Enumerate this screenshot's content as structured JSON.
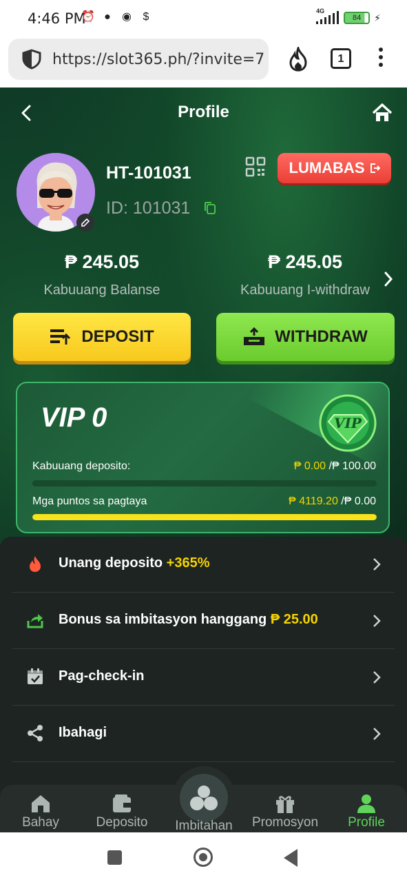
{
  "status_bar": {
    "time": "4:46 PM",
    "network": "4G",
    "battery": "84"
  },
  "browser": {
    "url": "https://slot365.ph/?invite=7",
    "tab_count": "1"
  },
  "header": {
    "title": "Profile"
  },
  "profile": {
    "username": "HT-101031",
    "id_text": "ID: 101031",
    "logout_label": "LUMABAS"
  },
  "balances": {
    "total_balance": "₱ 245.05",
    "total_balance_label": "Kabuuang Balanse",
    "withdrawable": "₱ 245.05",
    "withdrawable_label": "Kabuuang I-withdraw"
  },
  "actions": {
    "deposit_label": "DEPOSIT",
    "withdraw_label": "WITHDRAW"
  },
  "vip": {
    "title": "VIP 0",
    "badge_text": "VIP",
    "deposit_label": "Kabuuang deposito:",
    "deposit_current": "₱ 0.00",
    "deposit_target": " /₱ 100.00",
    "deposit_progress": 0,
    "bet_label": "Mga puntos sa pagtaya",
    "bet_current": "₱ 4119.20",
    "bet_target": " /₱ 0.00",
    "bet_progress": 1
  },
  "menu": [
    {
      "label": "Unang deposito ",
      "highlight": "+365%",
      "icon": "fire-icon"
    },
    {
      "label": "Bonus sa imbitasyon hanggang ",
      "highlight": "₱ 25.00",
      "icon": "share-arrow-icon"
    },
    {
      "label": "Pag-check-in",
      "highlight": "",
      "icon": "calendar-check-icon"
    },
    {
      "label": "Ibahagi",
      "highlight": "",
      "icon": "share-icon"
    }
  ],
  "bottom_nav": {
    "home": "Bahay",
    "deposit": "Deposito",
    "invite": "Imbitahan",
    "promo": "Promosyon",
    "profile": "Profile"
  },
  "colors": {
    "accent_green": "#5fd35a",
    "accent_yellow": "#f6d400",
    "logout_red": "#ea3f36"
  }
}
